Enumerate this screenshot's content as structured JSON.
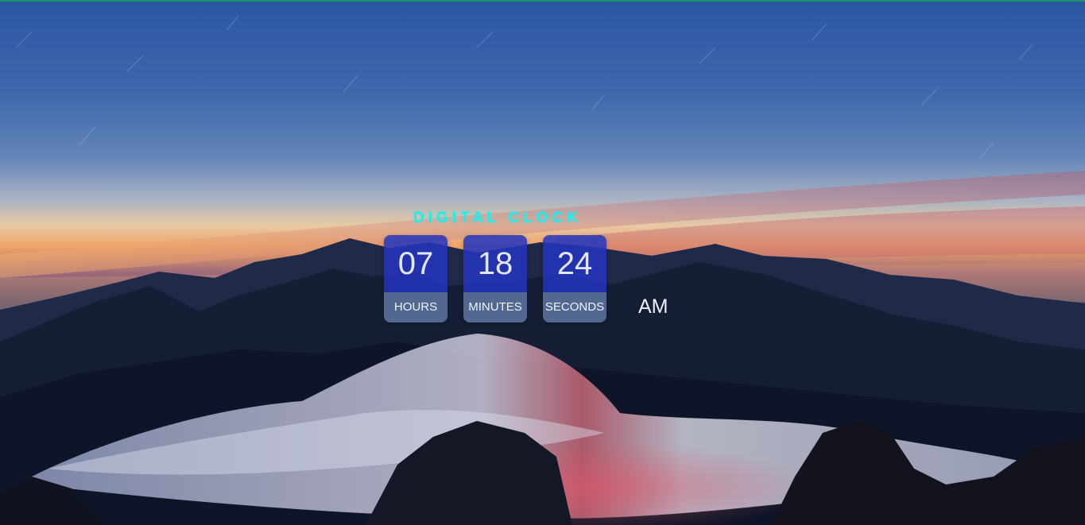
{
  "clock": {
    "title": "DIGITAL CLOCK",
    "hours": "07",
    "hours_label": "HOURS",
    "minutes": "18",
    "minutes_label": "MINUTES",
    "seconds": "24",
    "seconds_label": "SECONDS",
    "period": "AM"
  },
  "colors": {
    "title": "#17f0f0",
    "digit_box": "#2334be",
    "label_box": "#7896c8",
    "top_border": "#1e8f6b"
  },
  "background": {
    "scene": "mountain-sunset-icon"
  }
}
